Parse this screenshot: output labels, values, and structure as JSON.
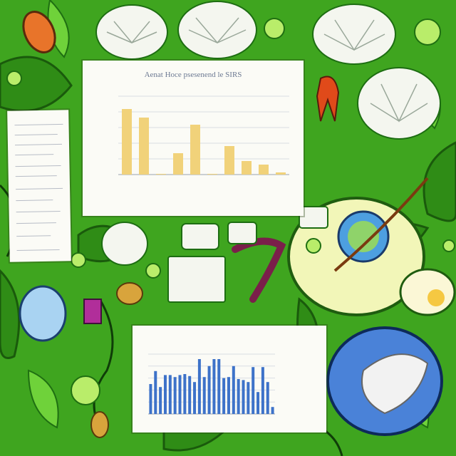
{
  "scene": {
    "palette": {
      "leaf_green": "#3fa51f",
      "dark_leaf": "#1f6f12",
      "bar_yellow": "#f1d27a",
      "bar_blue": "#3d72c9"
    },
    "icons": [
      "flower-icon",
      "seed-pod-icon",
      "blue-orb-icon",
      "plant-cell-icon",
      "tendril-icon"
    ]
  },
  "top_chart": {
    "title": "Aenat Hoce psesenend le SIRS"
  },
  "chart_data": [
    {
      "type": "bar",
      "title": "Aenat Hoce psesenend le SIRS",
      "series": [
        {
          "values": [
            92,
            80,
            1,
            30,
            70,
            1,
            40,
            19,
            14,
            3
          ]
        }
      ],
      "ylim": [
        0,
        110
      ],
      "grid": true,
      "color": "#f1d27a"
    },
    {
      "type": "bar",
      "series": [
        {
          "values": [
            30,
            43,
            27,
            39,
            39,
            37,
            39,
            40,
            38,
            32,
            55,
            37,
            48,
            55,
            55,
            36,
            37,
            48,
            35,
            34,
            32,
            47,
            22,
            47,
            32,
            7
          ]
        }
      ],
      "ylim": [
        0,
        60
      ],
      "grid": true,
      "color": "#3d72c9"
    }
  ]
}
